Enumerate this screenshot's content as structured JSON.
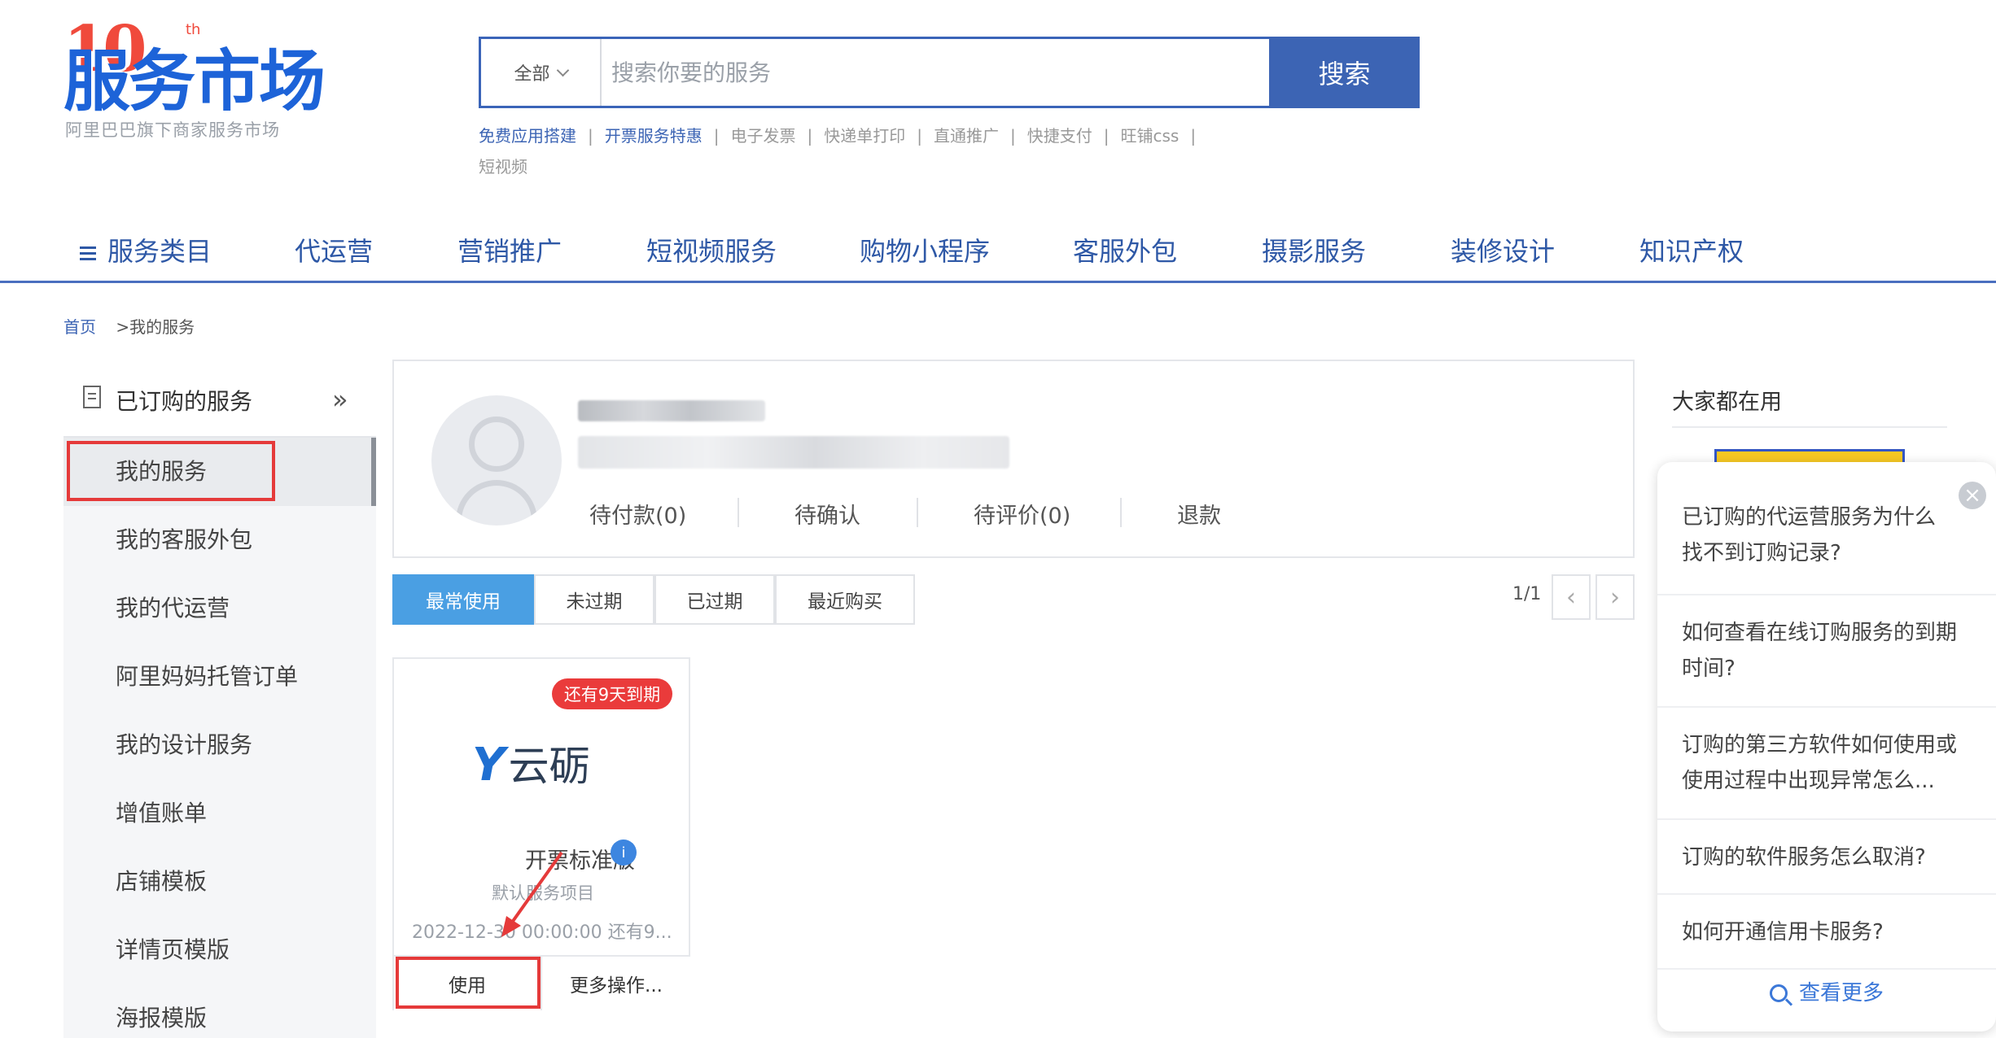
{
  "logo": {
    "anniversary": "10",
    "anniversary_suffix": "th",
    "name": "服务市场",
    "tagline": "阿里巴巴旗下商家服务市场"
  },
  "search": {
    "category": "全部",
    "placeholder": "搜索你要的服务",
    "button": "搜索",
    "hot_links": [
      "免费应用搭建",
      "开票服务特惠",
      "电子发票",
      "快递单打印",
      "直通推广",
      "快捷支付",
      "旺铺css",
      "短视频"
    ]
  },
  "nav": {
    "items": [
      "服务类目",
      "代运营",
      "营销推广",
      "短视频服务",
      "购物小程序",
      "客服外包",
      "摄影服务",
      "装修设计",
      "知识产权"
    ]
  },
  "breadcrumb": {
    "home": "首页",
    "separator": ">",
    "current": "我的服务"
  },
  "sidebar": {
    "header": "已订购的服务",
    "collapse": "»",
    "items": [
      "我的服务",
      "我的客服外包",
      "我的代运营",
      "阿里妈妈托管订单",
      "我的设计服务",
      "增值账单",
      "店铺模板",
      "详情页模版",
      "海报模版"
    ]
  },
  "profile": {
    "stats": [
      "待付款(0)",
      "待确认",
      "待评价(0)",
      "退款"
    ]
  },
  "tabs": {
    "items": [
      "最常使用",
      "未过期",
      "已过期",
      "最近购买"
    ],
    "page": "1/1",
    "prev": "‹",
    "next": "›"
  },
  "service_card": {
    "badge": "还有9天到期",
    "brand_mark": "Y",
    "brand_text": "云砺",
    "name": "开票标准版",
    "info": "i",
    "subtitle": "默认服务项目",
    "expiry": "2022-12-30 00:00:00 还有9...",
    "use_button": "使用",
    "more_button": "更多操作..."
  },
  "popular": {
    "title": "大家都在用"
  },
  "faq": {
    "close": "×",
    "items": [
      "已订购的代运营服务为什么找不到订购记录?",
      "如何查看在线订购服务的到期时间?",
      "订购的第三方软件如何使用或使用过程中出现异常怎么...",
      "订购的软件服务怎么取消?",
      "如何开通信用卡服务?"
    ],
    "more": "查看更多"
  },
  "colors": {
    "brand_blue": "#1d63d8",
    "search_blue": "#3c64b4",
    "tab_active": "#4a9fe3",
    "badge_red": "#ea3b3b",
    "annotation_red": "#e53a3a"
  }
}
